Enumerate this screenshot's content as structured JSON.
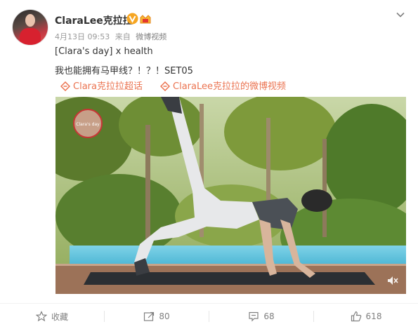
{
  "post": {
    "user_name": "ClaraLee克拉拉",
    "date": "4月13日 09:53",
    "source_prefix": "来自",
    "source": "微博视频",
    "text_line1": "[Clara's day] x health",
    "text_line2": "我也能拥有马甲线？！？！SET05",
    "link_topic": "Clara克拉拉超话",
    "link_video": "ClaraLee克拉拉的微博视频",
    "watermark": "Clara's day"
  },
  "actions": {
    "favorite": "收藏",
    "repost": "80",
    "comment": "68",
    "like": "618"
  },
  "colors": {
    "link": "#eb7350",
    "verified": "#f6a623",
    "muted_text": "#999999"
  },
  "icons": [
    "verified-icon",
    "member-icon",
    "chevron-down-icon",
    "topic-icon",
    "video-icon",
    "mute-icon",
    "star-icon",
    "repost-icon",
    "comment-icon",
    "like-icon"
  ]
}
